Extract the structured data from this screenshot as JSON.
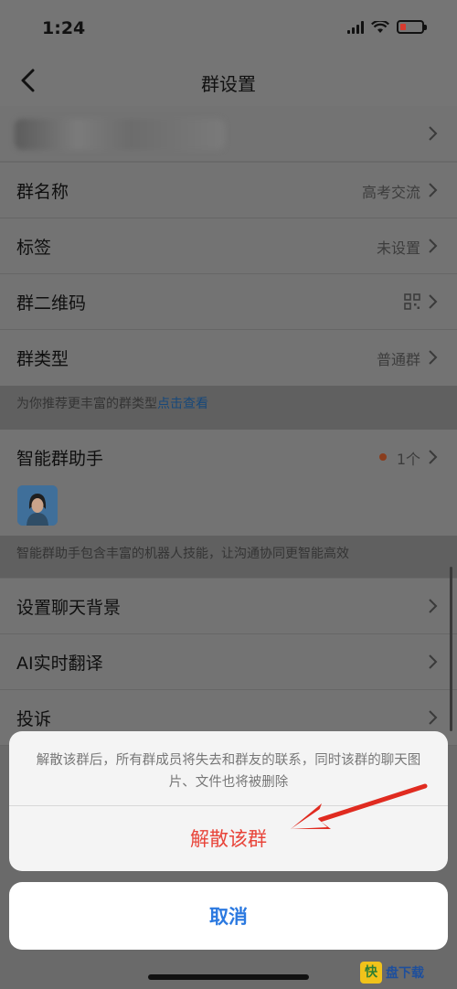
{
  "status": {
    "time": "1:24"
  },
  "nav": {
    "title": "群设置"
  },
  "rows": [
    {
      "label": "群名称",
      "value": "高考交流"
    },
    {
      "label": "标签",
      "value": "未设置"
    },
    {
      "label": "群二维码",
      "value": ""
    },
    {
      "label": "群类型",
      "value": "普通群"
    }
  ],
  "tip1": {
    "text": "为你推荐更丰富的群类型",
    "link": "点击查看"
  },
  "assistant": {
    "label": "智能群助手",
    "value": "1个"
  },
  "tip2": {
    "text": "智能群助手包含丰富的机器人技能，让沟通协同更智能高效"
  },
  "rows2": [
    {
      "label": "设置聊天背景"
    },
    {
      "label": "AI实时翻译"
    },
    {
      "label": "投诉"
    }
  ],
  "sheet": {
    "message": "解散该群后，所有群成员将失去和群友的联系，同时该群的聊天图片、文件也将被删除",
    "action": "解散该群",
    "cancel": "取消"
  },
  "watermark": {
    "logo": "快",
    "text": "盘下载"
  },
  "colors": {
    "danger": "#e8453a",
    "accent": "#2b79e0",
    "link": "#17487a"
  }
}
